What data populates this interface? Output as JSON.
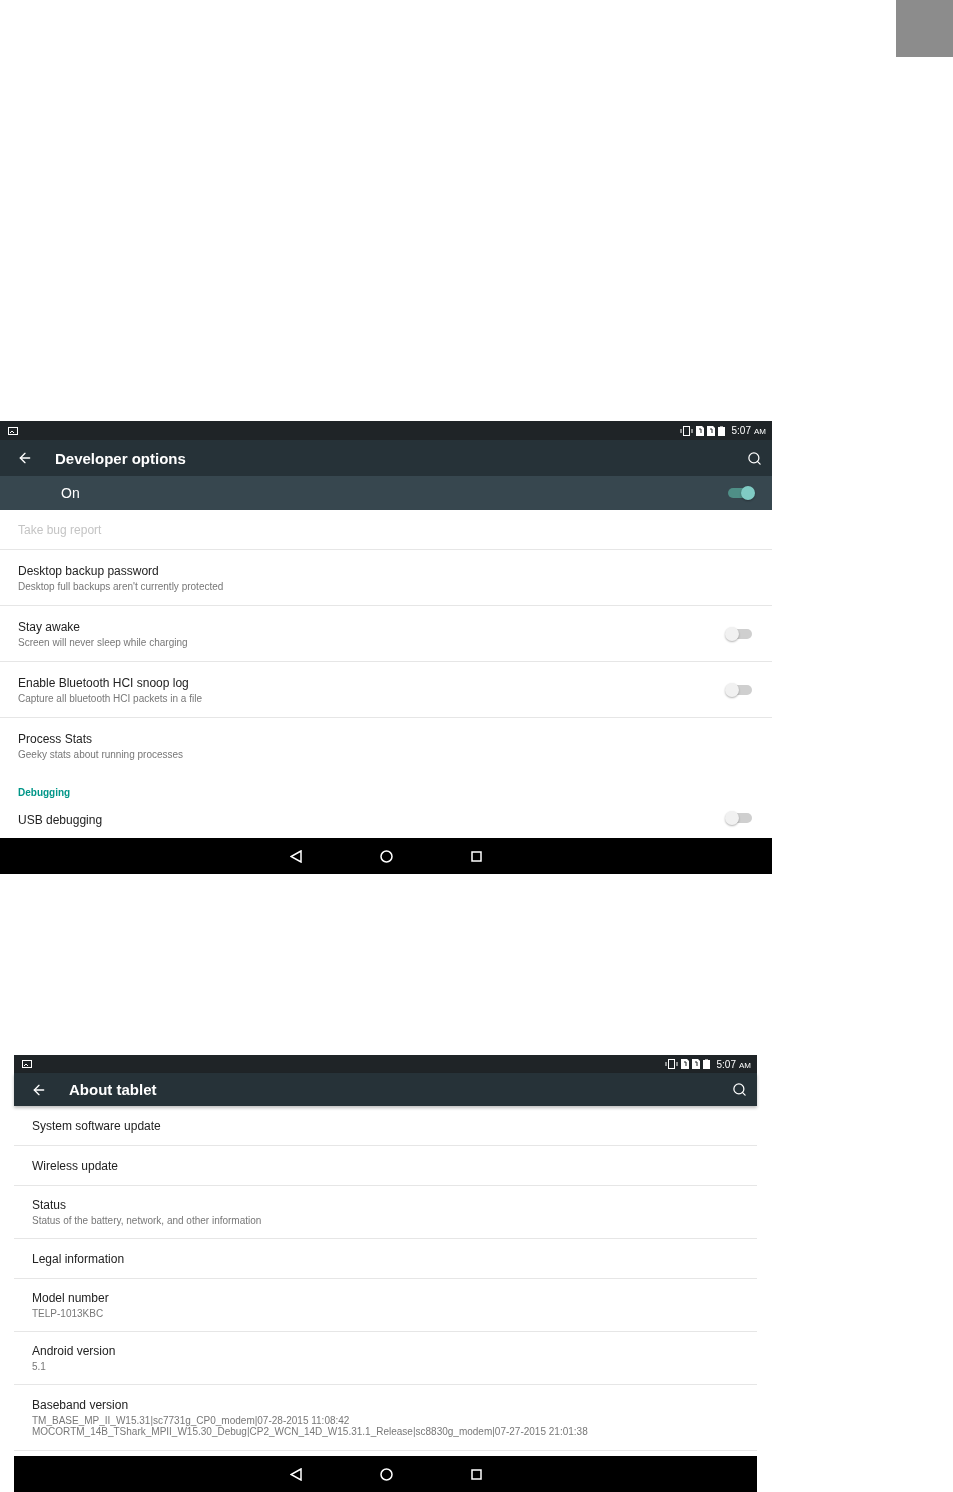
{
  "developer_screen": {
    "status_bar": {
      "time": "5:07",
      "meridiem": "AM"
    },
    "toolbar": {
      "title": "Developer options"
    },
    "master_switch": {
      "label": "On",
      "checked": true
    },
    "items": [
      {
        "kind": "plain",
        "title": "Take bug report",
        "disabled": true
      },
      {
        "kind": "plain",
        "title": "Desktop backup password",
        "subtitle": "Desktop full backups aren't currently protected",
        "disabled": false
      },
      {
        "kind": "switch",
        "title": "Stay awake",
        "subtitle": "Screen will never sleep while charging",
        "checked": false,
        "disabled": false
      },
      {
        "kind": "switch",
        "title": "Enable Bluetooth HCI snoop log",
        "subtitle": "Capture all bluetooth HCI packets in a file",
        "checked": false,
        "disabled": false
      },
      {
        "kind": "plain",
        "title": "Process Stats",
        "subtitle": "Geeky stats about running processes",
        "disabled": false,
        "divider": false
      },
      {
        "kind": "header",
        "title": "Debugging"
      },
      {
        "kind": "switch",
        "title": "USB debugging",
        "checked": false,
        "disabled": false
      }
    ]
  },
  "about_screen": {
    "status_bar": {
      "time": "5:07",
      "meridiem": "AM"
    },
    "toolbar": {
      "title": "About tablet"
    },
    "items": [
      {
        "title": "System software update"
      },
      {
        "title": "Wireless update"
      },
      {
        "title": "Status",
        "subtitle": "Status of the battery, network, and other information"
      },
      {
        "title": "Legal information"
      },
      {
        "title": "Model number",
        "subtitle": "TELP-1013KBC"
      },
      {
        "title": "Android version",
        "subtitle": "5.1"
      },
      {
        "title": "Baseband version",
        "subtitle": "TM_BASE_MP_II_W15.31|sc7731g_CP0_modem|07-28-2015 11:08:42",
        "subtitle2": "MOCORTM_14B_TShark_MPII_W15.30_Debug|CP2_WCN_14D_W15.31.1_Release|sc8830g_modem|07-27-2015 21:01:38"
      }
    ]
  }
}
